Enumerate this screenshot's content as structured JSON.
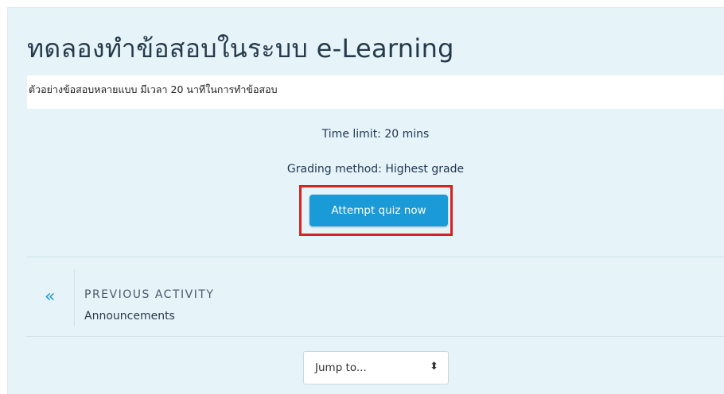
{
  "page": {
    "title": "ทดลองทำข้อสอบในระบบ e-Learning",
    "intro": "ตัวอย่างข้อสอบหลายแบบ มีเวลา 20 นาทีในการทำข้อสอบ"
  },
  "quiz_info": {
    "time_limit": "Time limit: 20 mins",
    "grading_method": "Grading method: Highest grade"
  },
  "actions": {
    "attempt_label": "Attempt quiz now"
  },
  "navigation": {
    "prev_chevron": "«",
    "prev_label": "PREVIOUS ACTIVITY",
    "prev_name": "Announcements",
    "jump_to": "Jump to...",
    "jump_arrow": "⬍"
  },
  "colors": {
    "accent": "#1a9ad6",
    "highlight_border": "#d92121",
    "background": "#e6f4fa"
  }
}
